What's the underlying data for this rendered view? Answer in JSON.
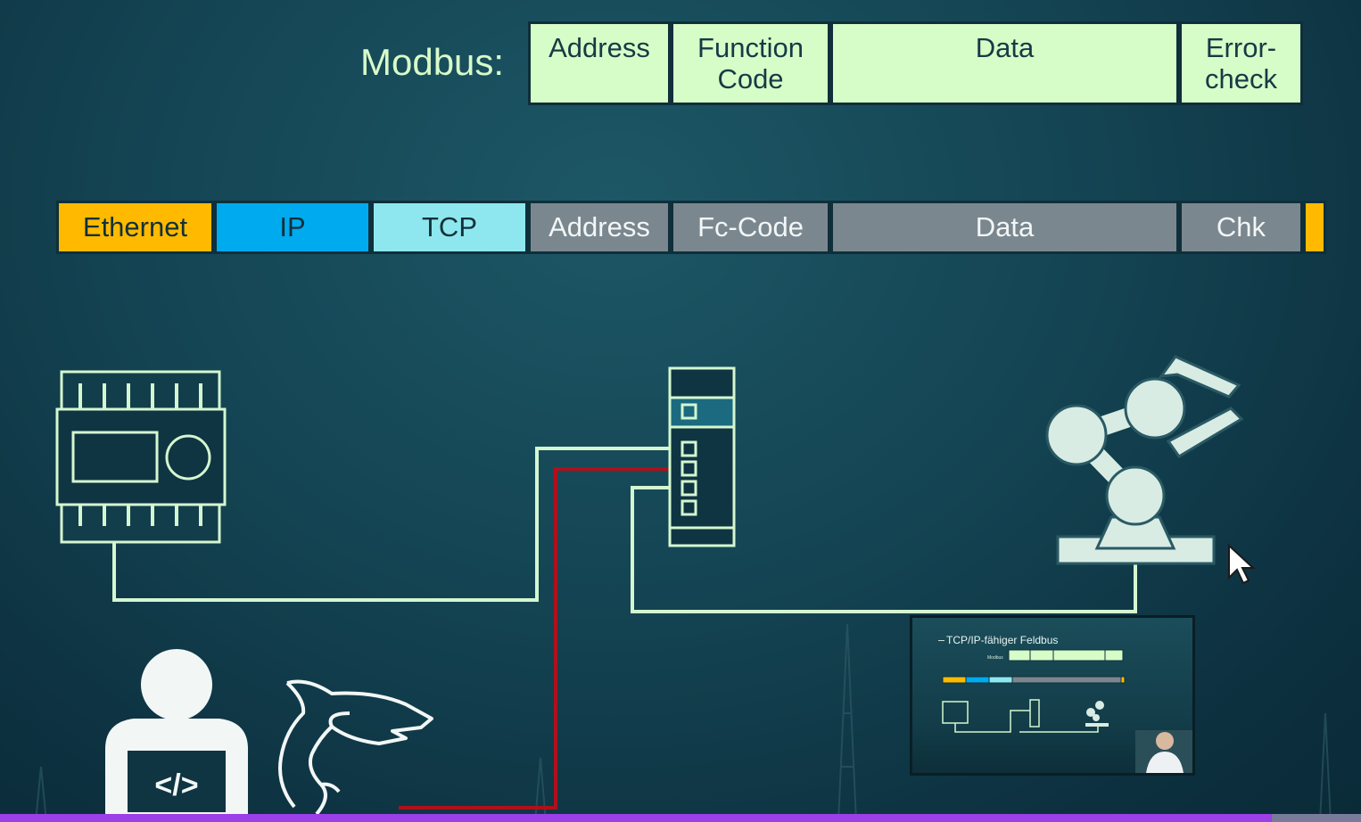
{
  "modbus_label": "Modbus:",
  "modbus_frame": [
    {
      "label": "Address"
    },
    {
      "label": "Function\nCode"
    },
    {
      "label": "Data"
    },
    {
      "label": "Error-\ncheck"
    }
  ],
  "tcp_frame": [
    {
      "label": "Ethernet",
      "color": "#ffba00"
    },
    {
      "label": "IP",
      "color": "#00aaee"
    },
    {
      "label": "TCP",
      "color": "#8ee7ee"
    },
    {
      "label": "Address",
      "color": "#7b878f"
    },
    {
      "label": "Fc-Code",
      "color": "#7b878f"
    },
    {
      "label": "Data",
      "color": "#7b878f"
    },
    {
      "label": "Chk",
      "color": "#7b878f"
    },
    {
      "label": "",
      "color": "#ffba00"
    }
  ],
  "icons": {
    "plc": "plc-controller-icon",
    "switch": "network-switch-icon",
    "robot": "robot-arm-icon",
    "developer": "developer-laptop-icon",
    "analyzer": "wireshark-shark-icon"
  },
  "colors": {
    "line": "#d4f7d0",
    "sniff_line": "#b0101a",
    "frame_light": "#d6fcc8",
    "background": "#144453"
  },
  "thumbnail": {
    "title": "TCP/IP-fähiger Feldbus",
    "modbus_label": "Modbus"
  }
}
